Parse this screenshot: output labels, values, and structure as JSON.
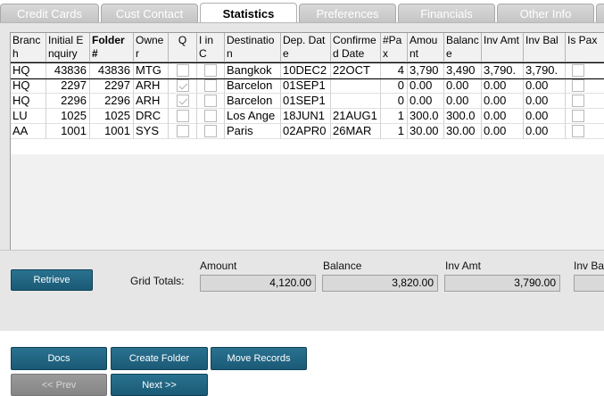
{
  "tabs": [
    {
      "label": "Credit Cards",
      "active": false
    },
    {
      "label": "Cust Contact",
      "active": false
    },
    {
      "label": "Statistics",
      "active": true
    },
    {
      "label": "Preferences",
      "active": false
    },
    {
      "label": "Financials",
      "active": false
    },
    {
      "label": "Other Info",
      "active": false
    }
  ],
  "grid": {
    "columns": [
      "Branch",
      "Initial Enquiry",
      "Folder #",
      "Owner",
      "Q",
      "I in C",
      "Destination",
      "Dep. Date",
      "Confirmed Date",
      "#Pax",
      "Amount",
      "Balance",
      "Inv Amt",
      "Inv Bal",
      "Is Pax"
    ],
    "rows": [
      {
        "branch": "HQ",
        "initial_enquiry": "43836",
        "folder": "43836",
        "owner": "MTG",
        "q": false,
        "i_in_c": false,
        "destination": "Bangkok",
        "dep_date": "10DEC2",
        "confirmed_date": "22OCT",
        "pax": "4",
        "amount": "3,790",
        "balance": "3,490",
        "inv_amt": "3,790.",
        "inv_bal": "3,790.",
        "is_pax": false
      },
      {
        "branch": "HQ",
        "initial_enquiry": "2297",
        "folder": "2297",
        "owner": "ARH",
        "q": true,
        "i_in_c": false,
        "destination": "Barcelon",
        "dep_date": "01SEP1",
        "confirmed_date": "",
        "pax": "0",
        "amount": "0.00",
        "balance": "0.00",
        "inv_amt": "0.00",
        "inv_bal": "0.00",
        "is_pax": false
      },
      {
        "branch": "HQ",
        "initial_enquiry": "2296",
        "folder": "2296",
        "owner": "ARH",
        "q": true,
        "i_in_c": false,
        "destination": "Barcelon",
        "dep_date": "01SEP1",
        "confirmed_date": "",
        "pax": "0",
        "amount": "0.00",
        "balance": "0.00",
        "inv_amt": "0.00",
        "inv_bal": "0.00",
        "is_pax": false
      },
      {
        "branch": "LU",
        "initial_enquiry": "1025",
        "folder": "1025",
        "owner": "DRC",
        "q": false,
        "i_in_c": false,
        "destination": "Los Ange",
        "dep_date": "18JUN1",
        "confirmed_date": "21AUG1",
        "pax": "1",
        "amount": "300.0",
        "balance": "300.0",
        "inv_amt": "0.00",
        "inv_bal": "0.00",
        "is_pax": false
      },
      {
        "branch": "AA",
        "initial_enquiry": "1001",
        "folder": "1001",
        "owner": "SYS",
        "q": false,
        "i_in_c": false,
        "destination": "Paris",
        "dep_date": "02APR0",
        "confirmed_date": "26MAR",
        "pax": "1",
        "amount": "30.00",
        "balance": "30.00",
        "inv_amt": "0.00",
        "inv_bal": "0.00",
        "is_pax": false
      }
    ]
  },
  "totals": {
    "retrieve_label": "Retrieve",
    "grid_totals_label": "Grid Totals:",
    "amount_label": "Amount",
    "amount_value": "4,120.00",
    "balance_label": "Balance",
    "balance_value": "3,820.00",
    "inv_amt_label": "Inv Amt",
    "inv_amt_value": "3,790.00",
    "inv_bal_label": "Inv Bal",
    "inv_bal_value": ""
  },
  "actions": {
    "docs_label": "Docs",
    "create_folder_label": "Create Folder",
    "move_records_label": "Move Records",
    "prev_label": "<< Prev",
    "next_label": "Next >>"
  },
  "colors": {
    "button": "#1f6382",
    "button_disabled": "#8f8f8f",
    "panel": "#e6e6e6"
  }
}
